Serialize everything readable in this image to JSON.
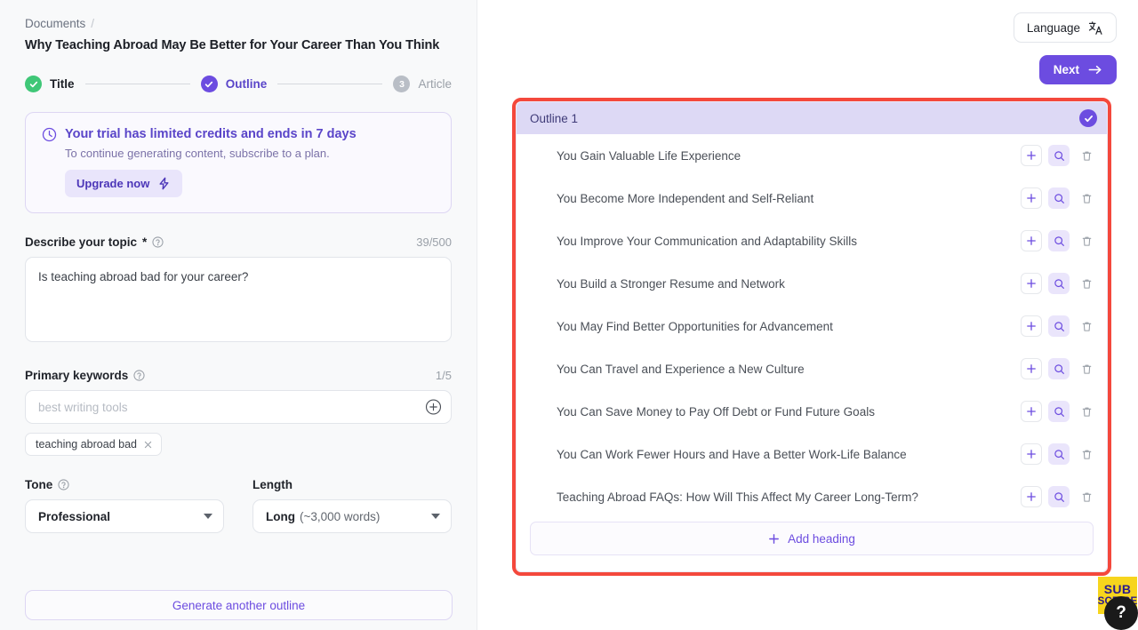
{
  "breadcrumb": {
    "root": "Documents",
    "separator": "/"
  },
  "document": {
    "title": "Why Teaching Abroad May Be Better for Your Career Than You Think"
  },
  "stepper": {
    "steps": [
      {
        "label": "Title",
        "state": "done",
        "marker": "check"
      },
      {
        "label": "Outline",
        "state": "active",
        "marker": "check"
      },
      {
        "label": "Article",
        "state": "idle",
        "marker": "3"
      }
    ]
  },
  "trial_banner": {
    "icon": "clock-icon",
    "title": "Your trial has limited credits and ends in 7 days",
    "subtitle": "To continue generating content, subscribe to a plan.",
    "button_label": "Upgrade now",
    "button_icon": "lightning-bolt-icon"
  },
  "topic": {
    "label": "Describe your topic",
    "required_mark": "*",
    "counter": "39/500",
    "value": "Is teaching abroad bad for your career?",
    "placeholder": "Describe your topic"
  },
  "keywords": {
    "label": "Primary keywords",
    "counter": "1/5",
    "placeholder": "best writing tools",
    "value": "",
    "add_icon": "plus-circle-icon",
    "chips": [
      {
        "label": "teaching abroad bad",
        "remove_icon": "close-icon"
      }
    ]
  },
  "tone": {
    "label": "Tone",
    "value": "Professional",
    "options": [
      "Professional"
    ]
  },
  "length": {
    "label": "Length",
    "value_strong": "Long",
    "value_weak": "(~3,000 words)",
    "options": [
      "Long (~3,000 words)"
    ]
  },
  "generate_button": {
    "label": "Generate another outline"
  },
  "top_actions": {
    "language_label": "Language",
    "language_icon": "translate-icon",
    "next_label": "Next",
    "next_icon": "arrow-right-icon"
  },
  "outline": {
    "title": "Outline 1",
    "selected": true,
    "selected_icon": "check-circle-icon",
    "row_actions": {
      "add_icon": "plus-icon",
      "search_icon": "magnifier-icon",
      "delete_icon": "trash-icon"
    },
    "headings": [
      "You Gain Valuable Life Experience",
      "You Become More Independent and Self-Reliant",
      "You Improve Your Communication and Adaptability Skills",
      "You Build a Stronger Resume and Network",
      "You May Find Better Opportunities for Advancement",
      "You Can Travel and Experience a New Culture",
      "You Can Save Money to Pay Off Debt or Fund Future Goals",
      "You Can Work Fewer Hours and Have a Better Work-Life Balance",
      "Teaching Abroad FAQs: How Will This Affect My Career Long-Term?"
    ],
    "add_heading_label": "Add heading",
    "add_heading_icon": "plus-icon"
  },
  "subscribe_widget": {
    "line1": "SUB",
    "line2": "SCRIBE",
    "help_label": "?"
  },
  "colors": {
    "accent_purple": "#6c4ce0",
    "accent_purple_dark": "#5a45c9",
    "highlight_red": "#f4483c",
    "success_green": "#3fc777",
    "sticker_yellow": "#f7d51d",
    "panel_bg": "#f8f9fa",
    "outline_header_bg": "#ddd9f5"
  }
}
